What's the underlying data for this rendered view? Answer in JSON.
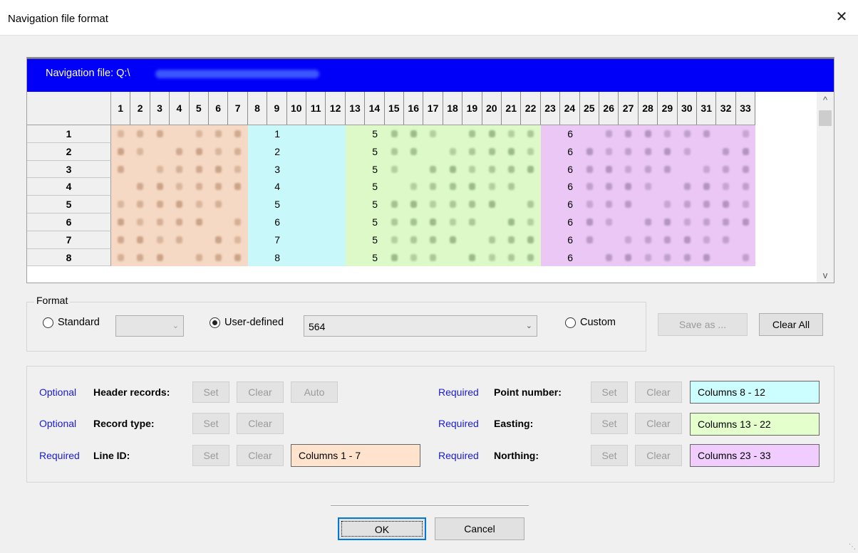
{
  "window": {
    "title": "Navigation file format",
    "close_glyph": "✕"
  },
  "grid": {
    "nav_label": "Navigation file: Q:\\",
    "columns": [
      "1",
      "2",
      "3",
      "4",
      "5",
      "6",
      "7",
      "8",
      "9",
      "10",
      "11",
      "12",
      "13",
      "14",
      "15",
      "16",
      "17",
      "18",
      "19",
      "20",
      "21",
      "22",
      "23",
      "24",
      "25",
      "26",
      "27",
      "28",
      "29",
      "30",
      "31",
      "32",
      "33"
    ],
    "rows": [
      "1",
      "2",
      "3",
      "4",
      "5",
      "6",
      "7",
      "8"
    ],
    "point_col_values": [
      "1",
      "2",
      "3",
      "4",
      "5",
      "6",
      "7",
      "8"
    ],
    "easting_col_values": [
      "5",
      "5",
      "5",
      "5",
      "5",
      "5",
      "5",
      "5"
    ],
    "northing_col_values": [
      "6",
      "6",
      "6",
      "6",
      "6",
      "6",
      "6",
      "6"
    ],
    "band_colors": {
      "line_id": "#f5d9c4",
      "point": "#c8f8f9",
      "easting": "#def9c8",
      "northing": "#eac7f5"
    },
    "scroll_up_glyph": "^",
    "scroll_down_glyph": "v"
  },
  "format": {
    "legend": "Format",
    "standard_label": "Standard",
    "user_defined_label": "User-defined",
    "user_defined_value": "564",
    "custom_label": "Custom",
    "selected": "user-defined",
    "save_as_label": "Save as ...",
    "clear_all_label": "Clear All"
  },
  "fields": {
    "header": {
      "status": "Optional",
      "name": "Header records:",
      "set": "Set",
      "clear": "Clear",
      "auto": "Auto"
    },
    "record_type": {
      "status": "Optional",
      "name": "Record type:",
      "set": "Set",
      "clear": "Clear"
    },
    "line_id": {
      "status": "Required",
      "name": "Line ID:",
      "set": "Set",
      "clear": "Clear",
      "columns": "Columns  1 -  7"
    },
    "point_number": {
      "status": "Required",
      "name": "Point number:",
      "set": "Set",
      "clear": "Clear",
      "columns": "Columns  8 - 12"
    },
    "easting": {
      "status": "Required",
      "name": "Easting:",
      "set": "Set",
      "clear": "Clear",
      "columns": "Columns 13 - 22"
    },
    "northing": {
      "status": "Required",
      "name": "Northing:",
      "set": "Set",
      "clear": "Clear",
      "columns": "Columns 23 - 33"
    }
  },
  "buttons": {
    "ok": "OK",
    "cancel": "Cancel"
  }
}
